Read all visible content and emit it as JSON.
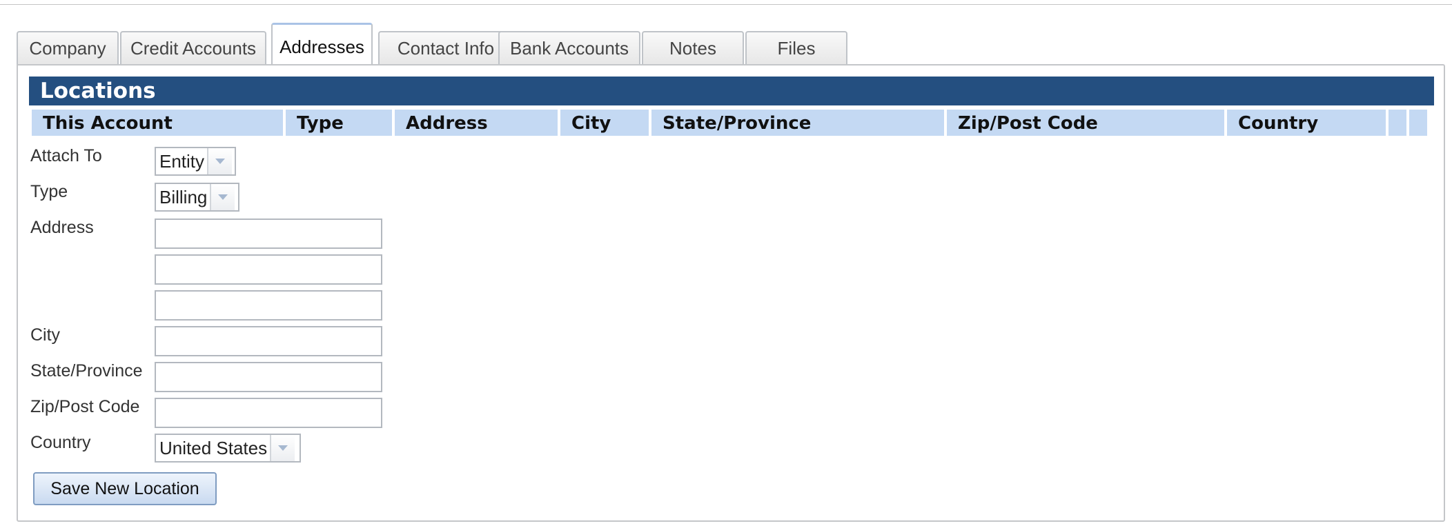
{
  "tabs": [
    {
      "label": "Company"
    },
    {
      "label": "Credit Accounts"
    },
    {
      "label": "Addresses"
    },
    {
      "label": "Contact Info"
    },
    {
      "label": "Bank Accounts"
    },
    {
      "label": "Notes"
    },
    {
      "label": "Files"
    }
  ],
  "active_tab": "Addresses",
  "panel": {
    "title": "Locations",
    "columns": [
      "This Account",
      "Type",
      "Address",
      "City",
      "State/Province",
      "Zip/Post Code",
      "Country",
      "",
      ""
    ]
  },
  "form": {
    "attach_to": {
      "label": "Attach To",
      "value": "Entity"
    },
    "type": {
      "label": "Type",
      "value": "Billing"
    },
    "address": {
      "label": "Address",
      "line1": "",
      "line2": "",
      "line3": ""
    },
    "city": {
      "label": "City",
      "value": ""
    },
    "state": {
      "label": "State/Province",
      "value": ""
    },
    "zip": {
      "label": "Zip/Post Code",
      "value": ""
    },
    "country": {
      "label": "Country",
      "value": "United States"
    },
    "save_label": "Save New Location"
  },
  "colors": {
    "header_bar": "#244f80",
    "column_header": "#c4d9f3",
    "button_border": "#7f9cc1"
  },
  "icons": {
    "dropdown": "chevron-down-icon"
  }
}
